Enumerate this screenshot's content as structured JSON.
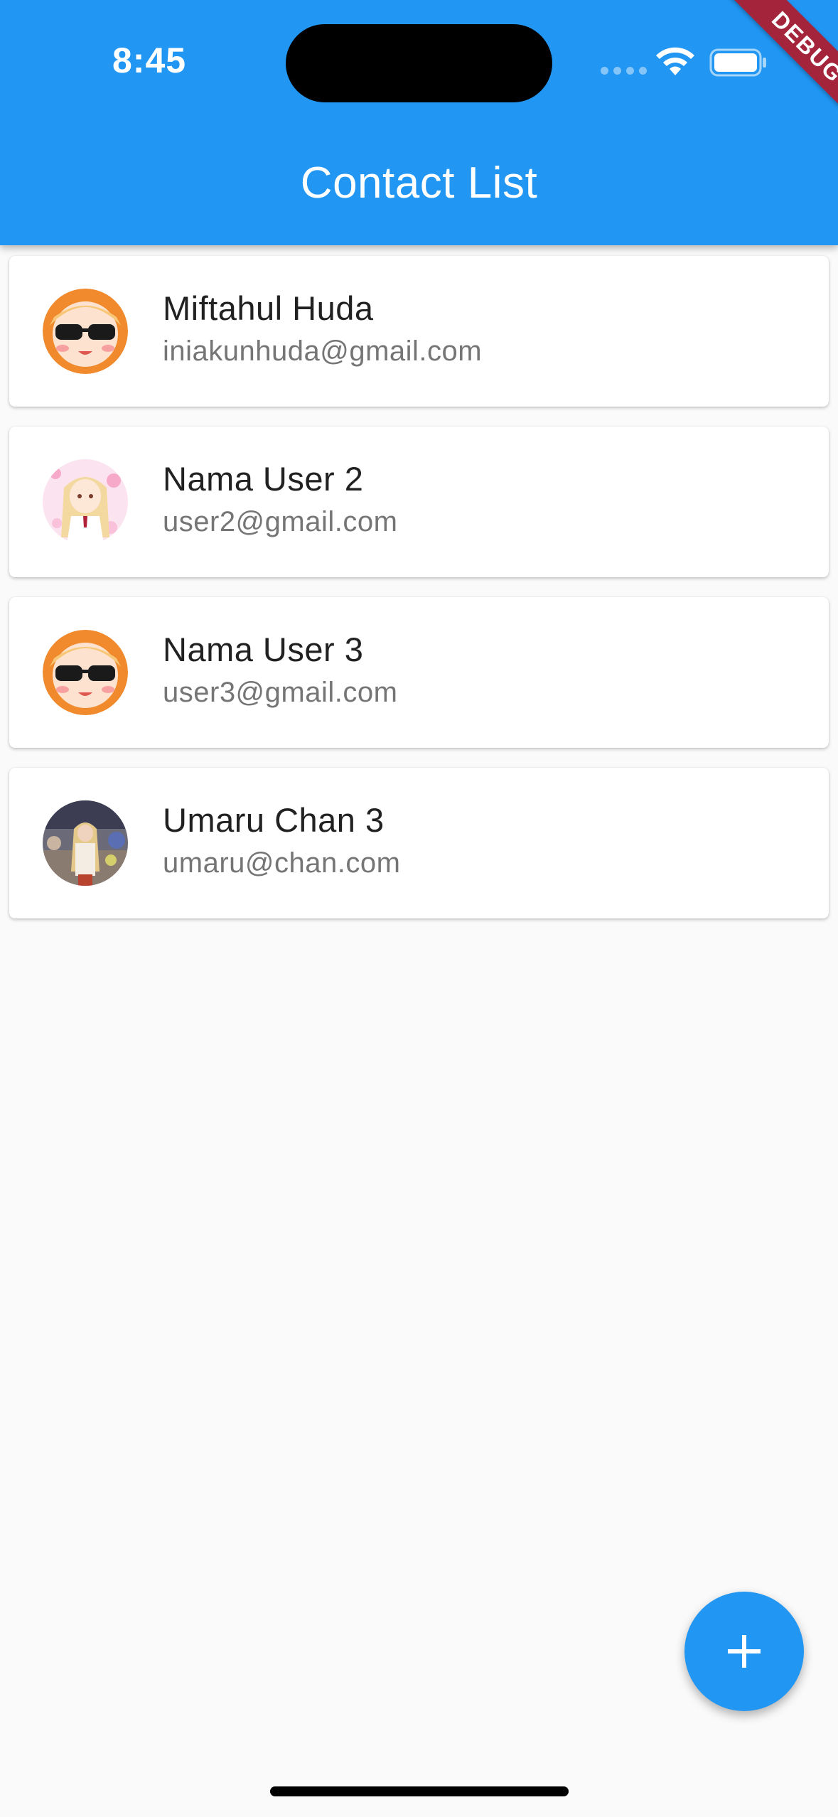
{
  "status_bar": {
    "time": "8:45"
  },
  "debug_banner": "DEBUG",
  "appbar": {
    "title": "Contact List",
    "color": "#2196f3"
  },
  "contacts": [
    {
      "name": "Miftahul Huda",
      "email": "iniakunhuda@gmail.com",
      "avatar": "anime-character-sunglasses"
    },
    {
      "name": "Nama User 2",
      "email": "user2@gmail.com",
      "avatar": "anime-character-pink"
    },
    {
      "name": "Nama User 3",
      "email": "user3@gmail.com",
      "avatar": "anime-character-sunglasses"
    },
    {
      "name": "Umaru Chan 3",
      "email": "umaru@chan.com",
      "avatar": "cosplay-photo"
    }
  ],
  "fab": {
    "icon": "plus-icon"
  }
}
